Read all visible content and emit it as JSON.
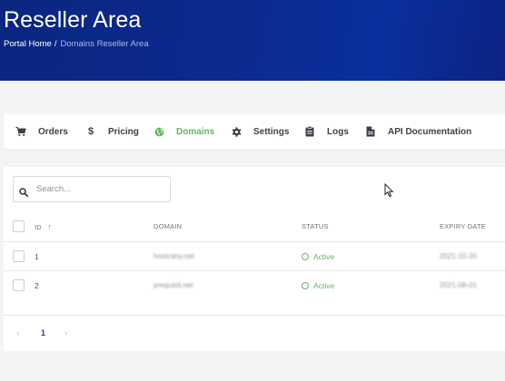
{
  "header": {
    "title": "Reseller Area",
    "breadcrumb": {
      "home": "Portal Home",
      "separator": "/",
      "current": "Domains Reseller Area"
    }
  },
  "tabs": [
    {
      "label": "Orders",
      "icon": "cart-icon"
    },
    {
      "label": "Pricing",
      "icon": "dollar-icon"
    },
    {
      "label": "Domains",
      "icon": "globe-icon",
      "active": true
    },
    {
      "label": "Settings",
      "icon": "gear-icon"
    },
    {
      "label": "Logs",
      "icon": "clipboard-icon"
    },
    {
      "label": "API Documentation",
      "icon": "file-icon"
    }
  ],
  "search": {
    "placeholder": "Search..."
  },
  "table": {
    "columns": {
      "id": "ID",
      "domain": "DOMAIN",
      "status": "STATUS",
      "expiry": "EXPIRY DATE"
    },
    "sort_indicator": "↑",
    "rows": [
      {
        "id": "1",
        "domain": "hostcany.net",
        "status": "Active",
        "expiry": "2021-10-20"
      },
      {
        "id": "2",
        "domain": "prequisit.net",
        "status": "Active",
        "expiry": "2021-08-01"
      }
    ]
  },
  "pagination": {
    "prev": "‹",
    "page": "1",
    "next": "›"
  },
  "colors": {
    "header_bg": "#0b2a8f",
    "active_tab": "#5cb85c",
    "status_active": "#5cb85c"
  }
}
